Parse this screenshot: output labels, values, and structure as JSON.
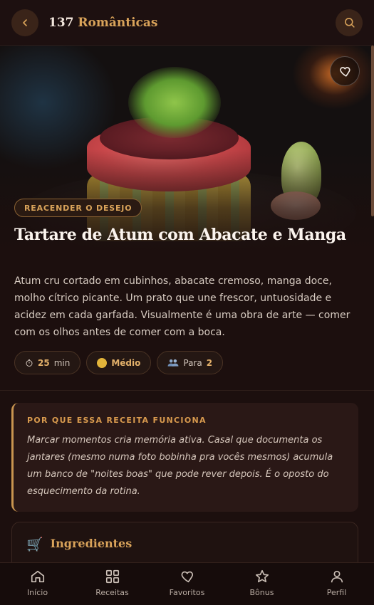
{
  "header": {
    "brand_number": "137",
    "brand_word": "Românticas",
    "back_icon": "chevron-left-icon",
    "search_icon": "search-icon"
  },
  "hero": {
    "favorite_icon": "heart-icon",
    "category_tag": "REACENDER O DESEJO",
    "title": "Tartare de Atum com Abacate e Manga"
  },
  "description": "Atum cru cortado em cubinhos, abacate cremoso, manga doce, molho cítrico picante. Um prato que une frescor, untuosidade e acidez em cada garfada. Visualmente é uma obra de arte — comer com os olhos antes de comer com a boca.",
  "meta": {
    "time_value": "25",
    "time_unit": "min",
    "difficulty": "Médio",
    "serves_label": "Para",
    "serves_value": "2"
  },
  "why": {
    "title": "POR QUE ESSA RECEITA FUNCIONA",
    "text": "Marcar momentos cria memória ativa. Casal que documenta os jantares (mesmo numa foto bobinha pra vocês mesmos) acumula um banco de \"noites boas\" que pode rever depois. É o oposto do esquecimento da rotina."
  },
  "ingredients": {
    "title": "Ingredientes",
    "icon": "cart-icon"
  },
  "nav": {
    "items": [
      {
        "label": "Início",
        "icon": "home-icon"
      },
      {
        "label": "Receitas",
        "icon": "grid-icon"
      },
      {
        "label": "Favoritos",
        "icon": "heart-icon"
      },
      {
        "label": "Bônus",
        "icon": "star-icon"
      },
      {
        "label": "Perfil",
        "icon": "user-icon"
      }
    ]
  },
  "colors": {
    "background": "#1c0f0e",
    "accent": "#d9a35a"
  }
}
